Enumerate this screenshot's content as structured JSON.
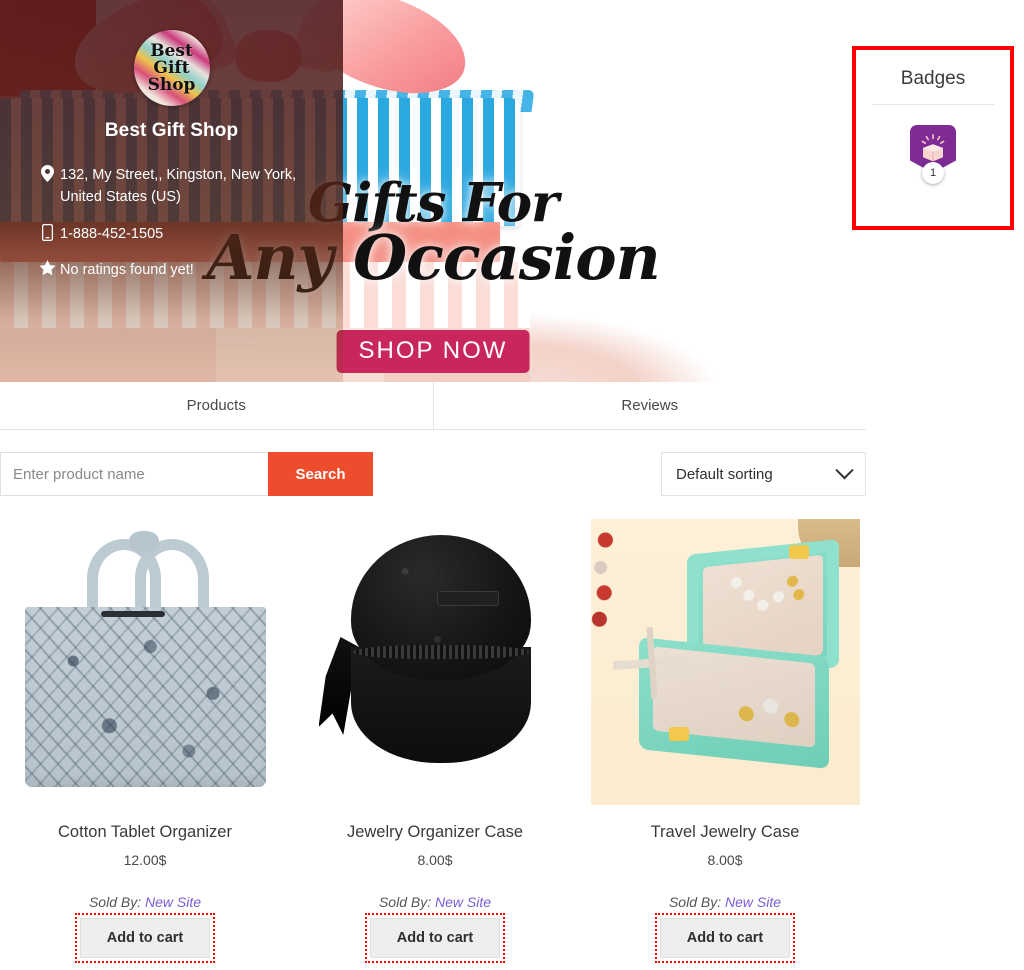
{
  "store": {
    "logo_text_lines": [
      "Best",
      "Gift",
      "Shop"
    ],
    "name": "Best Gift Shop",
    "address": "132, My Street,, Kingston, New York, United States (US)",
    "phone": "1-888-452-1505",
    "rating_text": "No ratings found yet!",
    "icons": {
      "location": "location-pin-icon",
      "phone": "mobile-phone-icon",
      "rating": "star-icon"
    }
  },
  "banner": {
    "headline_line1": "Gifts For",
    "headline_line2": "Any Occasion",
    "cta_label": "SHOP NOW",
    "cta_color": "#c8265c"
  },
  "badges": {
    "title": "Badges",
    "highlight_color": "#fe0000",
    "items": [
      {
        "icon": "gift-box-badge-icon",
        "count": "1",
        "color": "#7e2b96"
      }
    ]
  },
  "tabs": [
    {
      "label": "Products",
      "active": true
    },
    {
      "label": "Reviews",
      "active": false
    }
  ],
  "search": {
    "value": "",
    "placeholder": "Enter product name",
    "button_label": "Search",
    "button_color": "#ee4d2d"
  },
  "sorting": {
    "selected": "Default sorting",
    "icon": "chevron-down-icon"
  },
  "products": [
    {
      "title": "Cotton Tablet Organizer",
      "price": "12.00$",
      "sold_by_label": "Sold By:",
      "vendor": "New Site",
      "add_to_cart_label": "Add to cart",
      "image": "grey-floral-tote-bag"
    },
    {
      "title": "Jewelry Organizer Case",
      "price": "8.00$",
      "sold_by_label": "Sold By:",
      "vendor": "New Site",
      "add_to_cart_label": "Add to cart",
      "image": "round-black-jewelry-case"
    },
    {
      "title": "Travel Jewelry Case",
      "price": "8.00$",
      "sold_by_label": "Sold By:",
      "vendor": "New Site",
      "add_to_cart_label": "Add to cart",
      "image": "mint-travel-jewelry-box"
    }
  ]
}
